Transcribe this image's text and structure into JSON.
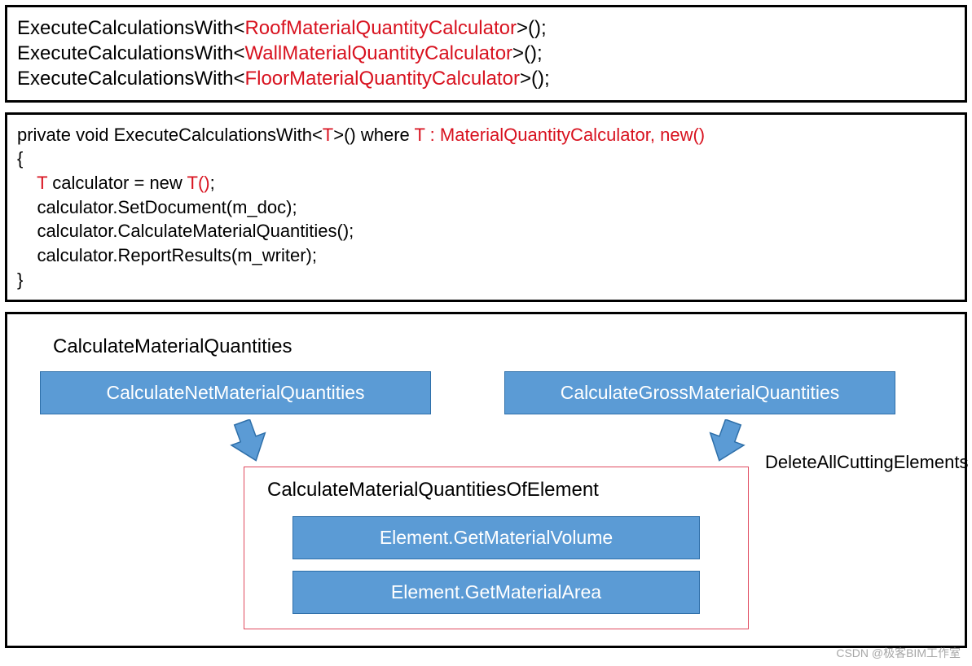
{
  "code1": {
    "prefix": "ExecuteCalculationsWith<",
    "suffix": ">();",
    "types": [
      "RoofMaterialQuantityCalculator",
      "WallMaterialQuantityCalculator",
      "FloorMaterialQuantityCalculator"
    ]
  },
  "code2": {
    "l1a": "private void ExecuteCalculationsWith<",
    "l1b": "T",
    "l1c": ">() where ",
    "l1d": "T : MaterialQuantityCalculator, new()",
    "l2": "{",
    "l3a": "    ",
    "l3b": "T",
    "l3c": " calculator = new ",
    "l3d": "T()",
    "l3e": ";",
    "l4": "    calculator.SetDocument(m_doc);",
    "l5": "    calculator.CalculateMaterialQuantities();",
    "l6": "    calculator.ReportResults(m_writer);",
    "l7": "}"
  },
  "diagram": {
    "title": "CalculateMaterialQuantities",
    "left": "CalculateNetMaterialQuantities",
    "right": "CalculateGrossMaterialQuantities",
    "sideLabel": "DeleteAllCuttingElements",
    "frameTitle": "CalculateMaterialQuantitiesOfElement",
    "inner1": "Element.GetMaterialVolume",
    "inner2": "Element.GetMaterialArea"
  },
  "watermark": "CSDN @极客BIM工作室"
}
